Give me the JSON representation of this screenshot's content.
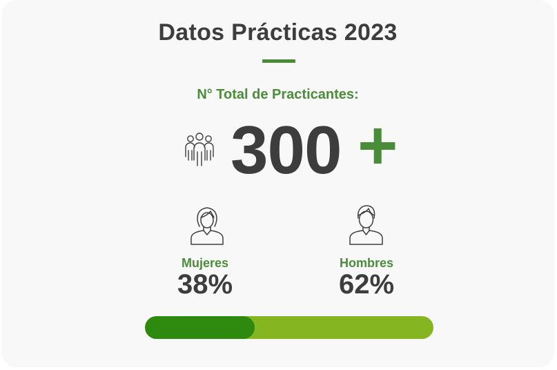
{
  "title": "Datos Prácticas 2023",
  "subtitle": "N° Total de Practicantes:",
  "total": {
    "number": "300",
    "suffix": "+",
    "icon": "group-people-icon"
  },
  "female": {
    "label": "Mujeres",
    "value": "38%",
    "fraction": 0.38,
    "icon": "female-user-icon"
  },
  "male": {
    "label": "Hombres",
    "value": "62%",
    "fraction": 0.62,
    "icon": "male-user-icon"
  },
  "colors": {
    "accent": "#4a8c3a",
    "text": "#3d3d3d",
    "bar_female": "#2d8a0e",
    "bar_male": "#86b522",
    "card_bg": "#f8f8f8"
  }
}
